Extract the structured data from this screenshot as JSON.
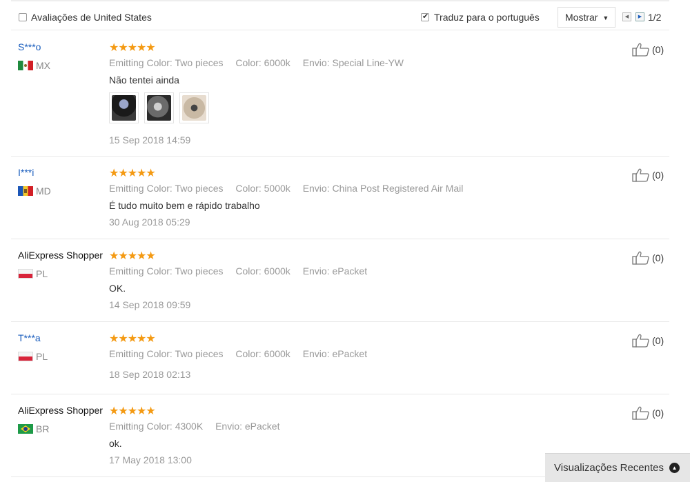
{
  "filter": {
    "country_label": "Avaliações de United States",
    "country_checked": false,
    "translate_label": "Traduz para o português",
    "translate_checked": true,
    "sort_label": "Mostrar",
    "sort_icon": "chevron-down-icon",
    "page_info": "1/2"
  },
  "reviews": [
    {
      "user": "S***o",
      "country": "MX",
      "rating": 5,
      "stars_text": "★★★★★",
      "attrs": [
        {
          "key": "Emitting Color:",
          "value": "Two pieces"
        },
        {
          "key": "Color:",
          "value": "6000k"
        },
        {
          "key": "Envio:",
          "value": "Special Line-YW"
        }
      ],
      "comment": "Não tentei ainda",
      "photos": 3,
      "date": "15 Sep 2018 14:59",
      "likes": "(0)"
    },
    {
      "user": "I***i",
      "country": "MD",
      "rating": 5,
      "stars_text": "★★★★★",
      "attrs": [
        {
          "key": "Emitting Color:",
          "value": "Two pieces"
        },
        {
          "key": "Color:",
          "value": "5000k"
        },
        {
          "key": "Envio:",
          "value": "China Post Registered Air Mail"
        }
      ],
      "comment": "É tudo muito bem e rápido trabalho",
      "date": "30 Aug 2018 05:29",
      "likes": "(0)"
    },
    {
      "user": "AliExpress Shopper",
      "country": "PL",
      "rating": 5,
      "stars_text": "★★★★★",
      "attrs": [
        {
          "key": "Emitting Color:",
          "value": "Two pieces"
        },
        {
          "key": "Color:",
          "value": "6000k"
        },
        {
          "key": "Envio:",
          "value": "ePacket"
        }
      ],
      "comment": "OK.",
      "date": "14 Sep 2018 09:59",
      "likes": "(0)"
    },
    {
      "user": "T***a",
      "country": "PL",
      "rating": 5,
      "stars_text": "★★★★★",
      "attrs": [
        {
          "key": "Emitting Color:",
          "value": "Two pieces"
        },
        {
          "key": "Color:",
          "value": "6000k"
        },
        {
          "key": "Envio:",
          "value": "ePacket"
        }
      ],
      "comment": "",
      "date": "18 Sep 2018 02:13",
      "likes": "(0)"
    },
    {
      "user": "AliExpress Shopper",
      "country": "BR",
      "rating": 5,
      "stars_text": "★★★★★",
      "attrs": [
        {
          "key": "Emitting Color:",
          "value": "4300K"
        },
        {
          "key": "Envio:",
          "value": "ePacket"
        }
      ],
      "comment": "ok.",
      "date": "17 May 2018 13:00",
      "likes": "(0)"
    }
  ],
  "recent": {
    "label": "Visualizações Recentes",
    "icon": "chevron-up-circle-icon"
  },
  "colors": {
    "star": "#f49a13",
    "masked_user": "#1a5dbd",
    "muted": "#999999"
  }
}
